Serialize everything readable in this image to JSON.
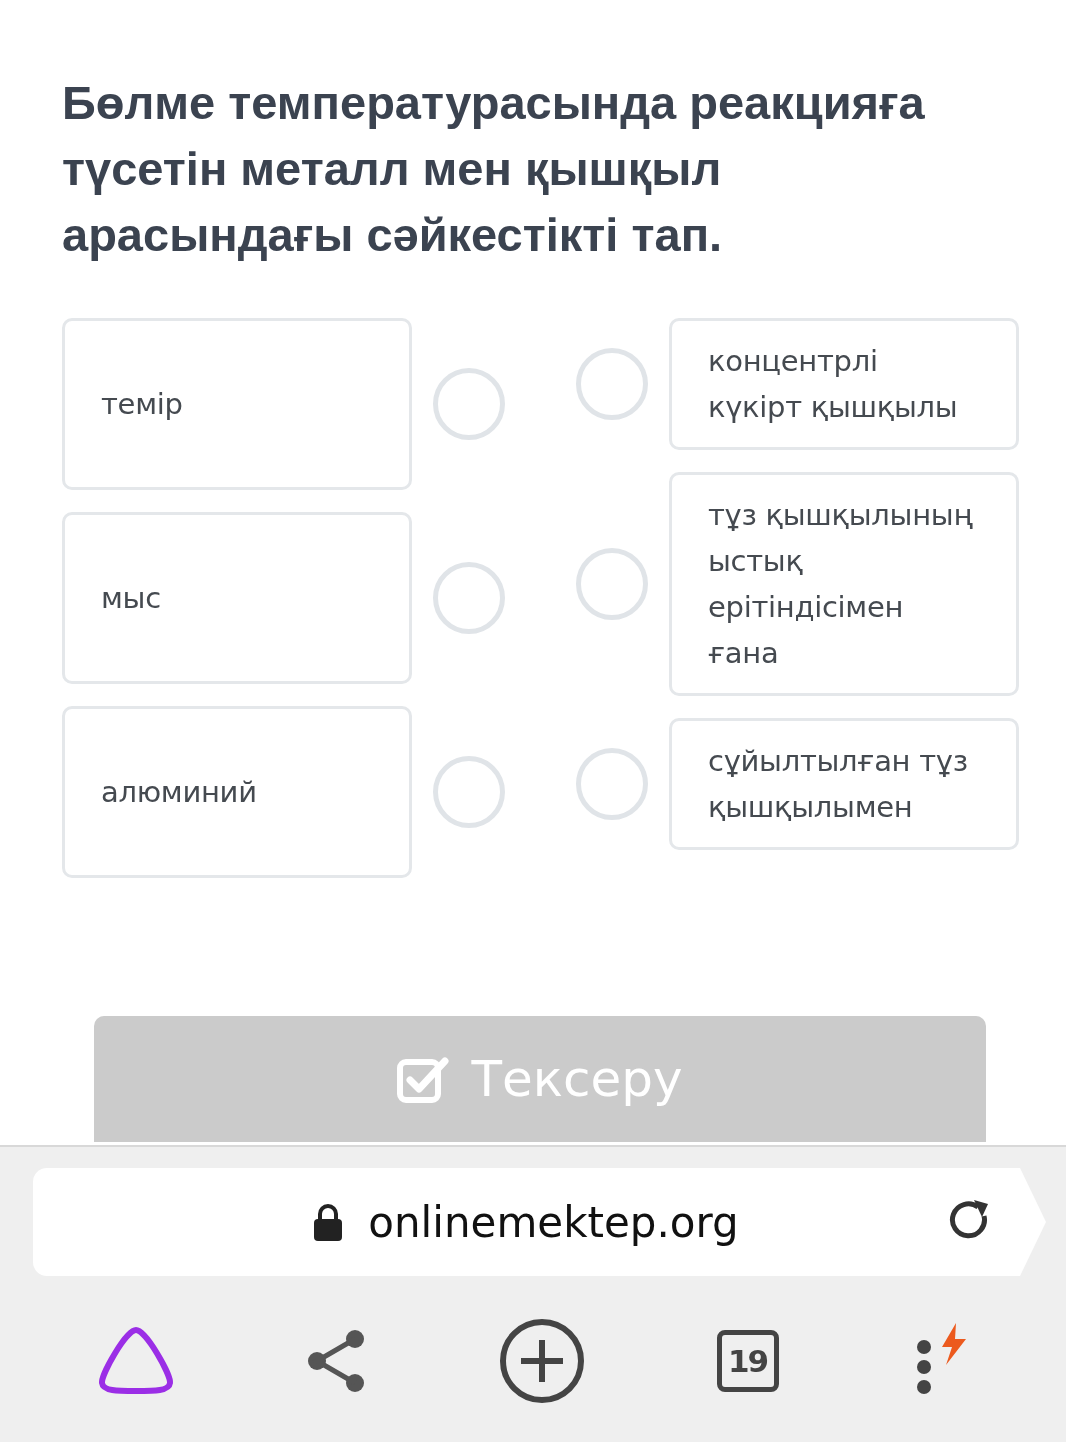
{
  "question": "Бөлме температурасында реакцияға түсетін металл мен қышқыл арасындағы сәйкестікті тап.",
  "left_items": [
    {
      "text": "темір"
    },
    {
      "text": "мыс"
    },
    {
      "text": "алюминий"
    }
  ],
  "right_items": [
    {
      "text": "концентрлі күкірт қышқылы"
    },
    {
      "text": "тұз қышқылының ыстық ерітіндісімен ғана"
    },
    {
      "text": "сұйылтылған тұз қышқылымен"
    }
  ],
  "check_button": {
    "label": "Тексеру",
    "disabled": true
  },
  "browser": {
    "url": "onlinemektep.org",
    "tab_count": "19"
  }
}
